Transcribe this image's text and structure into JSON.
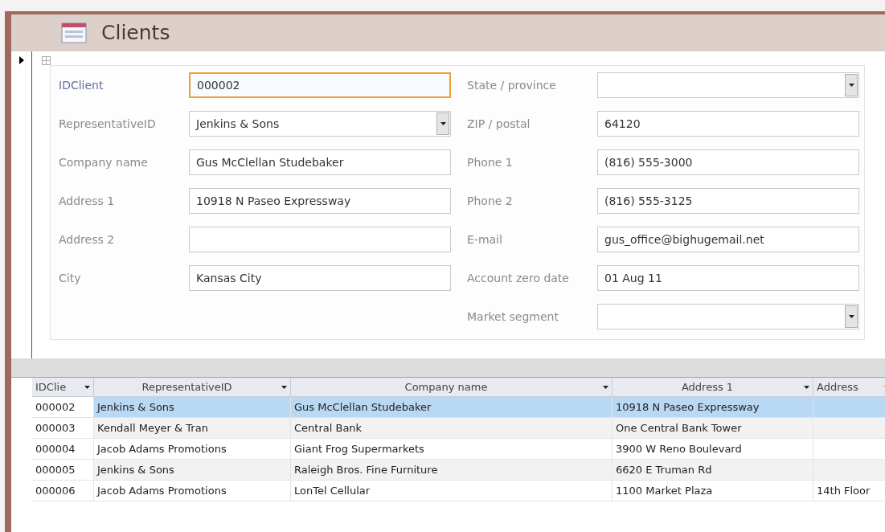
{
  "title": "Clients",
  "form": {
    "left": [
      {
        "label": "IDClient",
        "value": "000002",
        "kind": "text",
        "focused": true
      },
      {
        "label": "RepresentativeID",
        "value": "Jenkins & Sons",
        "kind": "combo",
        "focused": false
      },
      {
        "label": "Company name",
        "value": "Gus McClellan Studebaker",
        "kind": "text",
        "focused": false
      },
      {
        "label": "Address 1",
        "value": "10918 N Paseo Expressway",
        "kind": "text",
        "focused": false
      },
      {
        "label": "Address 2",
        "kind": "text",
        "focused": false
      },
      {
        "label": "City",
        "value": "Kansas City",
        "kind": "text",
        "focused": false
      }
    ],
    "right": [
      {
        "label": "State / province",
        "kind": "combo",
        "focused": false
      },
      {
        "label": "ZIP / postal",
        "value": "64120",
        "kind": "text",
        "focused": false
      },
      {
        "label": "Phone 1",
        "value": "(816) 555-3000",
        "kind": "text",
        "focused": false
      },
      {
        "label": "Phone 2",
        "value": "(816) 555-3125",
        "kind": "text",
        "focused": false
      },
      {
        "label": "E-mail",
        "value": "gus_office@bighugemail.net",
        "kind": "text",
        "focused": false
      },
      {
        "label": "Account zero date",
        "value": "01 Aug 11",
        "kind": "text",
        "focused": false
      },
      {
        "label": "Market segment",
        "kind": "combo",
        "focused": false
      }
    ]
  },
  "table": {
    "columns": [
      "IDClie",
      "RepresentativeID",
      "Company name",
      "Address 1",
      "Address"
    ],
    "rows": [
      {
        "cells": [
          "000002",
          "Jenkins & Sons",
          "Gus McClellan Studebaker",
          "10918 N Paseo Expressway",
          null
        ],
        "selected": true
      },
      {
        "cells": [
          "000003",
          "Kendall Meyer & Tran",
          "Central Bank",
          "One Central Bank Tower",
          null
        ],
        "selected": false
      },
      {
        "cells": [
          "000004",
          "Jacob Adams Promotions",
          "Giant Frog Supermarkets",
          "3900 W Reno Boulevard",
          null
        ],
        "selected": false
      },
      {
        "cells": [
          "000005",
          "Jenkins & Sons",
          "Raleigh Bros. Fine Furniture",
          "6620 E Truman Rd",
          null
        ],
        "selected": false
      },
      {
        "cells": [
          "000006",
          "Jacob Adams Promotions",
          "LonTel Cellular",
          "1100 Market Plaza",
          "14th Floor"
        ],
        "selected": false
      }
    ]
  }
}
